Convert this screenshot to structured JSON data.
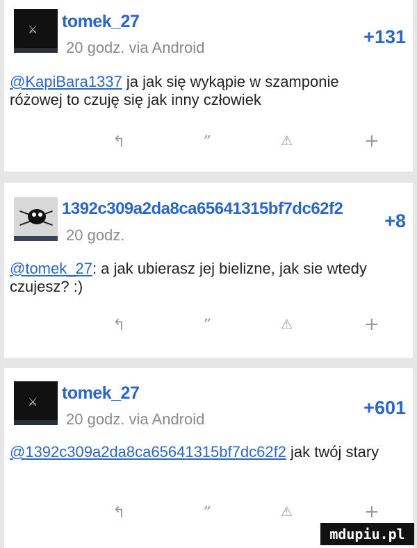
{
  "posts": [
    {
      "username": "tomek_27",
      "meta": "20 godz. via Android",
      "score": "+131",
      "mention": "@KapiBara1337",
      "text": " ja jak się wykąpie w szamponie różowej to czuję się jak inny człowiek",
      "avatar": "dark-figure"
    },
    {
      "username": "1392c309a2da8ca65641315bf7dc62f2",
      "meta": "20 godz.",
      "score": "+8",
      "mention": "@tomek_27",
      "text": ": a jak ubierasz jej bielizne, jak sie wtedy czujesz? :)",
      "avatar": "bug-photo"
    },
    {
      "username": "tomek_27",
      "meta": "20 godz. via Android",
      "score": "+601",
      "mention": "@1392c309a2da8ca65641315bf7dc62f2",
      "text": " jak twój stary",
      "avatar": "dark-figure"
    }
  ],
  "actions": {
    "reply": "reply-icon",
    "quote": "quote-icon",
    "report": "warning-icon",
    "plus": "plus-icon"
  },
  "watermark": "mdupiu.pl",
  "colors": {
    "accent": "#2a66c7",
    "muted": "#8a8a8a",
    "background": "#e6e6e6"
  }
}
